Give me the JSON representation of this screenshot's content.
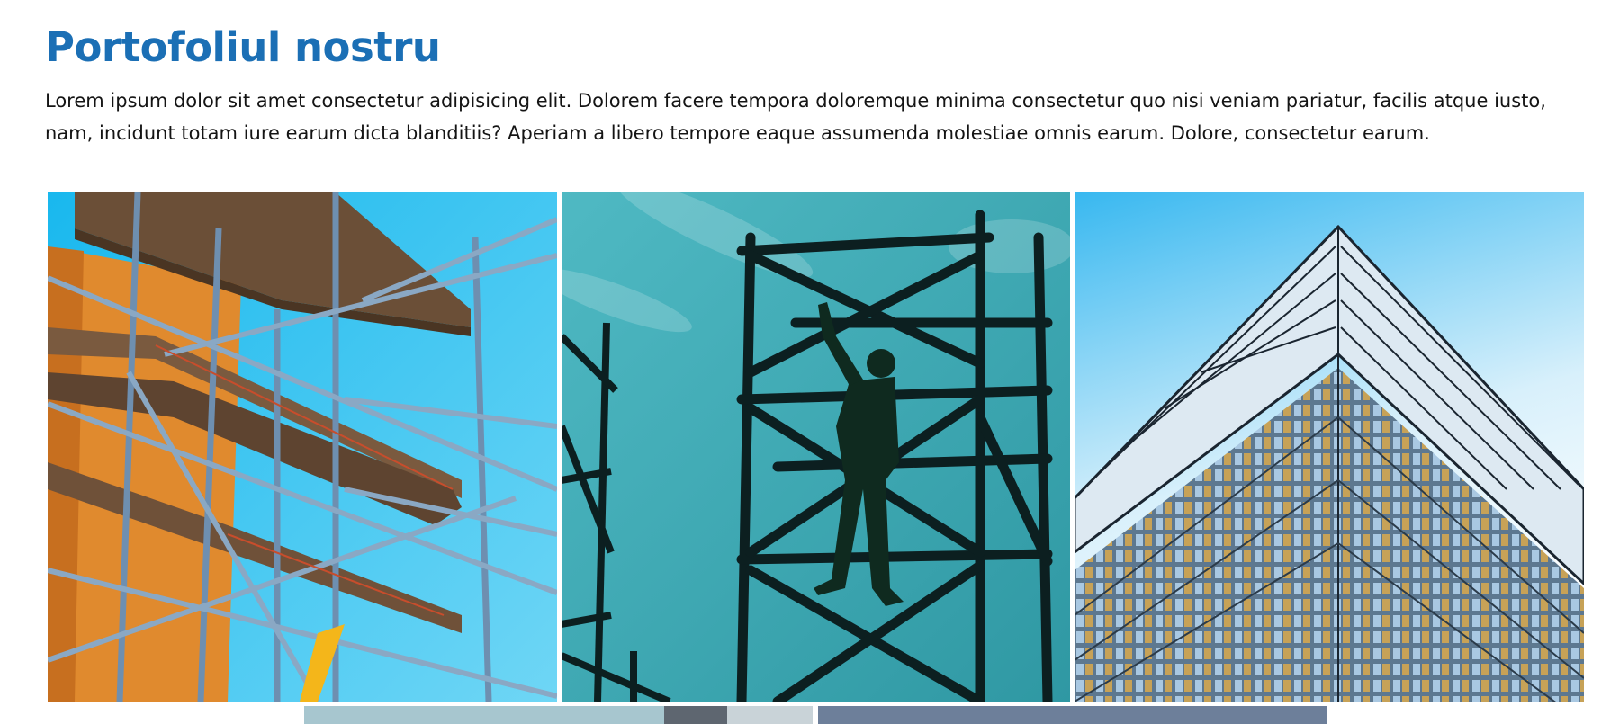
{
  "portfolio": {
    "title": "Portofoliul nostru",
    "description": "Lorem ipsum dolor sit amet consectetur adipisicing elit. Dolorem facere tempora doloremque minima consectetur quo nisi veniam pariatur, facilis atque iusto, nam, incidunt totam iure earum dicta blanditiis? Aperiam a libero tempore eaque assumenda molestiae omnis earum. Dolore, consectetur earum."
  },
  "colors": {
    "title": "#1b6fb5",
    "sky_bright": "#2cc6f2",
    "sky_teal": "#3aa7b1",
    "facade_orange": "#e08a2e"
  },
  "gallery": [
    {
      "icon": "photo-scaffolding-orange-wall"
    },
    {
      "icon": "photo-worker-silhouette-scaffold"
    },
    {
      "icon": "photo-glass-building-corner"
    },
    {
      "icon": "photo-building-partial"
    },
    {
      "icon": "photo-sky-partial"
    }
  ]
}
